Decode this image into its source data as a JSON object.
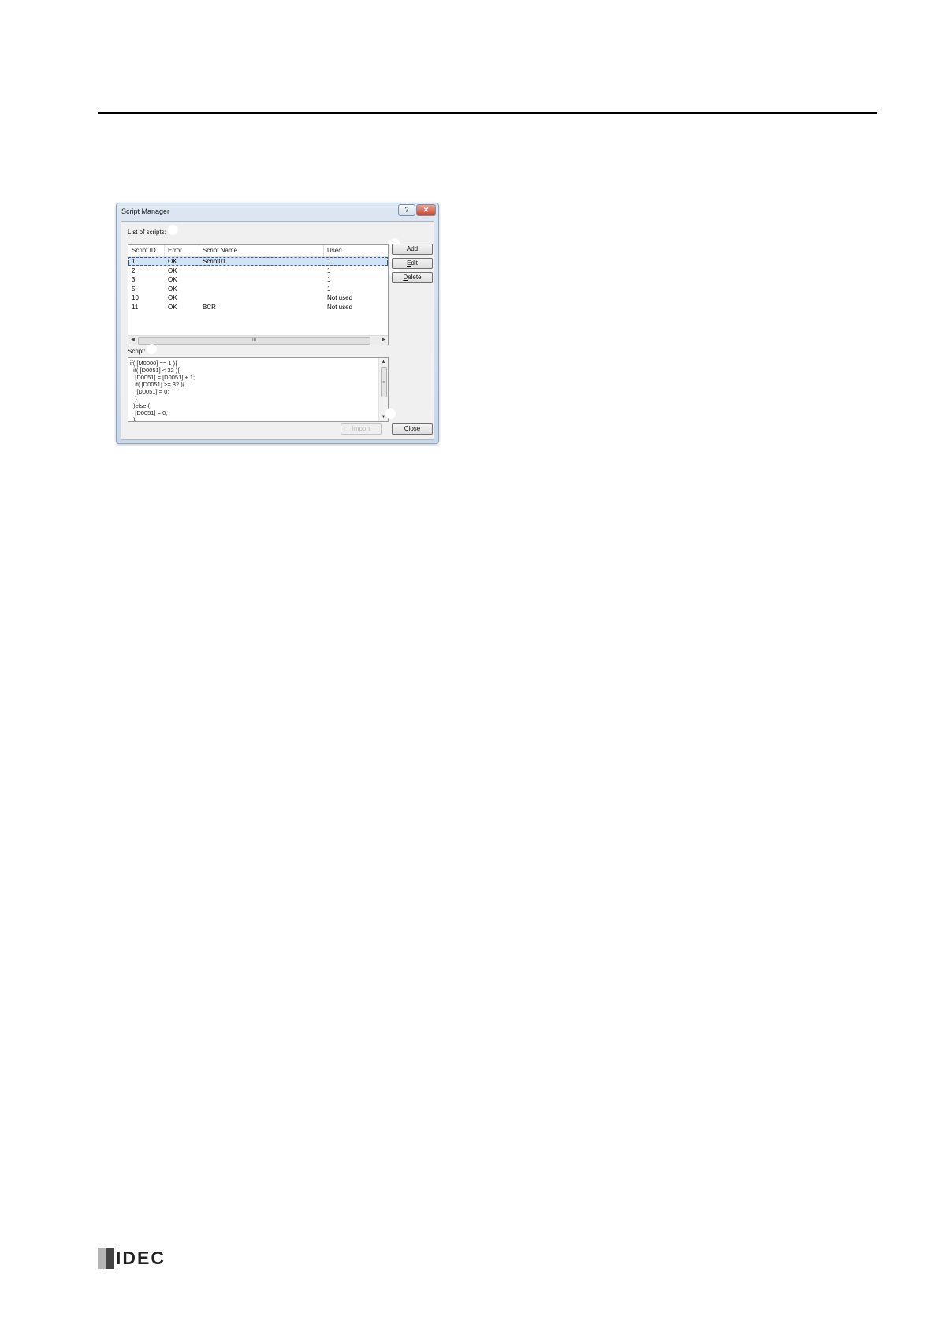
{
  "dialog": {
    "title": "Script Manager",
    "help_glyph": "?",
    "close_glyph": "✕",
    "list_label": "List of scripts:",
    "columns": [
      "Script ID",
      "Error",
      "Script Name",
      "Used"
    ],
    "rows": [
      {
        "id": "1",
        "error": "OK",
        "name": "Script01",
        "used": "1",
        "selected": true
      },
      {
        "id": "2",
        "error": "OK",
        "name": "",
        "used": "1",
        "selected": false
      },
      {
        "id": "3",
        "error": "OK",
        "name": "",
        "used": "1",
        "selected": false
      },
      {
        "id": "5",
        "error": "OK",
        "name": "",
        "used": "1",
        "selected": false
      },
      {
        "id": "10",
        "error": "OK",
        "name": "",
        "used": "Not used",
        "selected": false
      },
      {
        "id": "11",
        "error": "OK",
        "name": "BCR",
        "used": "Not used",
        "selected": false
      }
    ],
    "hscroll_grip": "III",
    "script_label": "Script:",
    "script_code": "if( [M0000] == 1 ){\n  if( [D0051] < 32 ){\n   [D0051] = [D0051] + 1;\n   if( [D0051] >= 32 ){\n    [D0051] = 0;\n   }\n  }else {\n   [D0051] = 0;\n  }",
    "buttons": {
      "add_pre": "",
      "add_key": "A",
      "add_post": "dd",
      "edit_pre": "",
      "edit_key": "E",
      "edit_post": "dit",
      "delete_pre": "",
      "delete_key": "D",
      "delete_post": "elete",
      "import": "Import",
      "close": "Close"
    }
  },
  "footer": {
    "logo_text": "IDEC"
  }
}
